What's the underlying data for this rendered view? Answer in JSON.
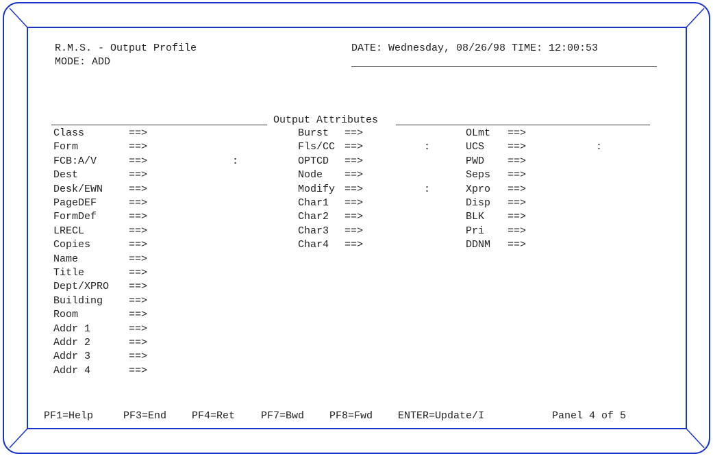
{
  "frame": {
    "outer_color": "#1a33cc",
    "inner_color": "#1a33cc",
    "background": "#ffffff"
  },
  "header": {
    "title": "R.M.S. - Output Profile",
    "mode": "MODE: ADD",
    "datetime": "DATE: Wednesday, 08/26/98 TIME: 12:00:53"
  },
  "section_title": "Output Attributes",
  "arrow": "==>",
  "colon": ":",
  "fields": {
    "col1": [
      "Class",
      "Form",
      "FCB:A/V",
      "Dest",
      "Desk/EWN",
      "PageDEF",
      "FormDef",
      "LRECL",
      "Copies",
      "Name",
      "Title",
      "Dept/XPRO",
      "Building",
      "Room",
      "Addr 1",
      "Addr 2",
      "Addr 3",
      "Addr 4"
    ],
    "col2": [
      "Burst",
      "Fls/CC",
      "OPTCD",
      "Node",
      "Modify",
      "Char1",
      "Char2",
      "Char3",
      "Char4"
    ],
    "col3": [
      "OLmt",
      "UCS",
      "PWD",
      "Seps",
      "Xpro",
      "Disp",
      "BLK",
      "Pri",
      "DDNM"
    ]
  },
  "footer": {
    "keys": [
      "PF1=Help",
      "PF3=End",
      "PF4=Ret",
      "PF7=Bwd",
      "PF8=Fwd",
      "ENTER=Update/I"
    ],
    "panel": "Panel 4 of 5"
  }
}
